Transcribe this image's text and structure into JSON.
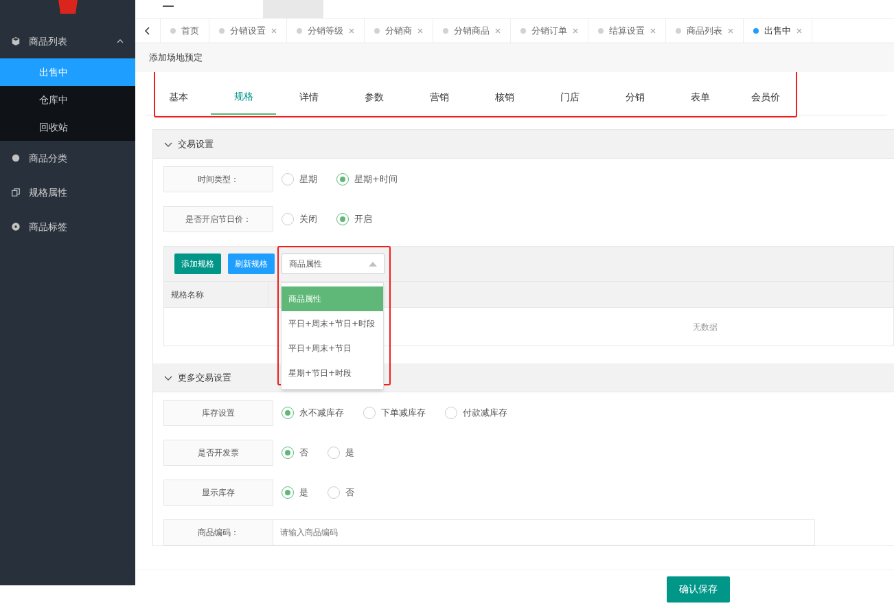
{
  "sidebar": {
    "items": [
      {
        "label": "商品列表",
        "expanded": true,
        "children": [
          {
            "label": "出售中",
            "selected": true
          },
          {
            "label": "仓库中",
            "selected": false
          },
          {
            "label": "回收站",
            "selected": false
          }
        ]
      },
      {
        "label": "商品分类"
      },
      {
        "label": "规格属性"
      },
      {
        "label": "商品标签"
      }
    ]
  },
  "tab_strip": {
    "tabs": [
      {
        "label": "首页",
        "closable": false,
        "selected": false
      },
      {
        "label": "分销设置",
        "closable": true,
        "selected": false
      },
      {
        "label": "分销等级",
        "closable": true,
        "selected": false
      },
      {
        "label": "分销商",
        "closable": true,
        "selected": false
      },
      {
        "label": "分销商品",
        "closable": true,
        "selected": false
      },
      {
        "label": "分销订单",
        "closable": true,
        "selected": false
      },
      {
        "label": "结算设置",
        "closable": true,
        "selected": false
      },
      {
        "label": "商品列表",
        "closable": true,
        "selected": false
      },
      {
        "label": "出售中",
        "closable": true,
        "selected": true
      }
    ]
  },
  "page_title": "添加场地预定",
  "form_tabs": [
    {
      "label": "基本",
      "selected": false
    },
    {
      "label": "规格",
      "selected": true
    },
    {
      "label": "详情",
      "selected": false
    },
    {
      "label": "参数",
      "selected": false
    },
    {
      "label": "营销",
      "selected": false
    },
    {
      "label": "核销",
      "selected": false
    },
    {
      "label": "门店",
      "selected": false
    },
    {
      "label": "分销",
      "selected": false
    },
    {
      "label": "表单",
      "selected": false
    },
    {
      "label": "会员价",
      "selected": false
    }
  ],
  "trade_section": {
    "title": "交易设置",
    "expanded": true,
    "rows": [
      {
        "label": "时间类型：",
        "options": [
          {
            "label": "星期",
            "selected": false
          },
          {
            "label": "星期+时间",
            "selected": true
          }
        ]
      },
      {
        "label": "是否开启节日价：",
        "options": [
          {
            "label": "关闭",
            "selected": false
          },
          {
            "label": "开启",
            "selected": true
          }
        ]
      }
    ],
    "spec": {
      "add_button": "添加规格",
      "refresh_button": "刷新规格",
      "select": {
        "value": "商品属性",
        "open": true,
        "options": [
          {
            "label": "商品属性",
            "selected": true
          },
          {
            "label": "平日+周末+节日+时段",
            "selected": false
          },
          {
            "label": "平日+周末+节日",
            "selected": false
          },
          {
            "label": "星期+节日+时段",
            "selected": false
          }
        ]
      },
      "columns": [
        "规格名称"
      ],
      "empty_text": "无数据"
    }
  },
  "more_section": {
    "title": "更多交易设置",
    "expanded": true,
    "rows": [
      {
        "label": "库存设置",
        "options": [
          {
            "label": "永不减库存",
            "selected": true
          },
          {
            "label": "下单减库存",
            "selected": false
          },
          {
            "label": "付款减库存",
            "selected": false
          }
        ]
      },
      {
        "label": "是否开发票",
        "options": [
          {
            "label": "否",
            "selected": true
          },
          {
            "label": "是",
            "selected": false
          }
        ]
      },
      {
        "label": "显示库存",
        "options": [
          {
            "label": "是",
            "selected": true
          },
          {
            "label": "否",
            "selected": false
          }
        ]
      }
    ],
    "code_field": {
      "label": "商品编码：",
      "placeholder": "请输入商品编码"
    }
  },
  "save_button": "确认保存"
}
